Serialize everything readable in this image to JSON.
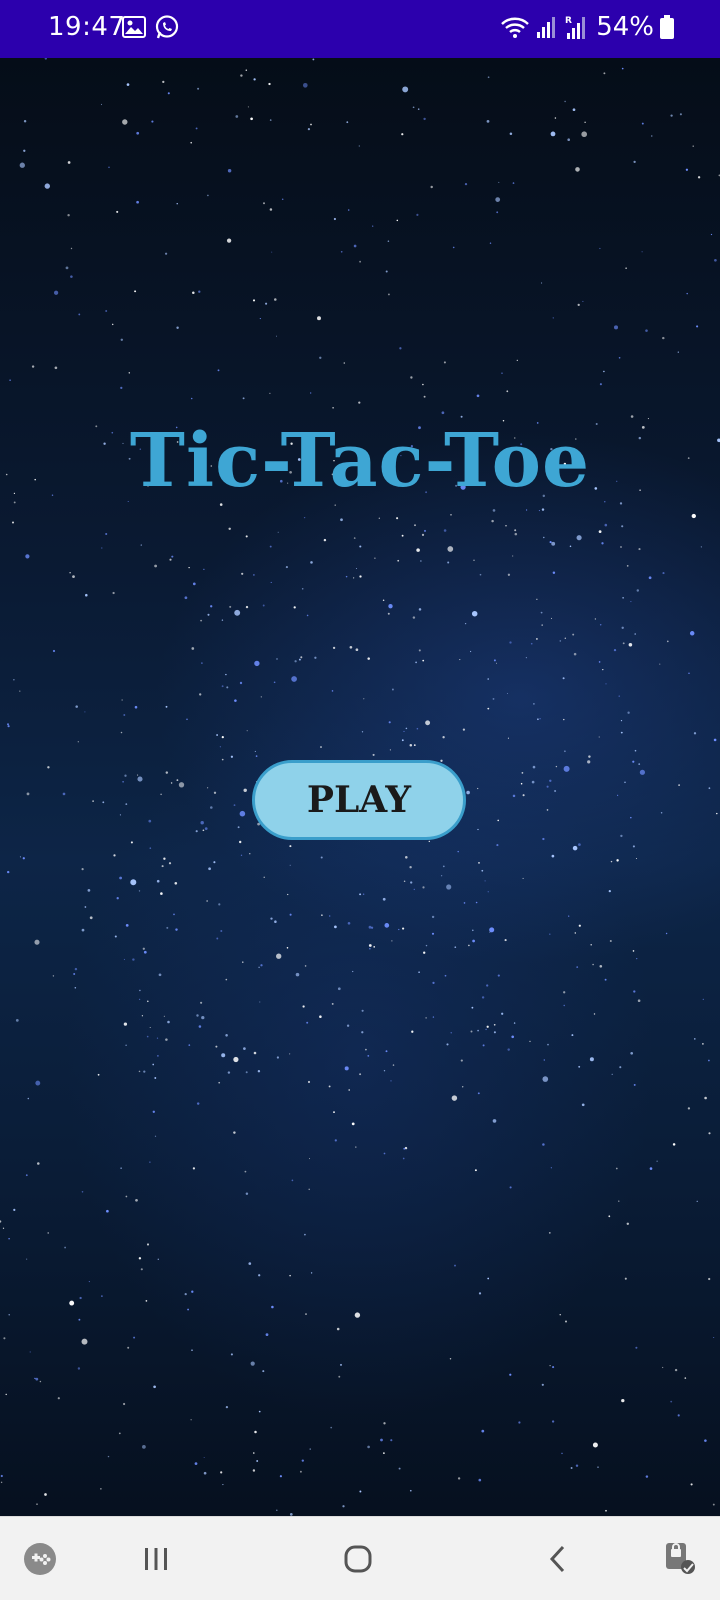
{
  "status_bar": {
    "time": "19:47",
    "battery": "54%",
    "background": "#2c00ad",
    "icons": [
      "gallery-icon",
      "whatsapp-icon",
      "wifi-icon",
      "signal-icon",
      "roaming-signal-icon",
      "battery-icon"
    ]
  },
  "app": {
    "title": "Tic-Tac-Toe",
    "play_label": "PLAY",
    "title_color": "#3ea6d4",
    "button_color": "#8fd2ea"
  },
  "nav_bar": {
    "icons": [
      "game-launcher-icon",
      "recent-apps-icon",
      "home-icon",
      "back-icon",
      "keyboard-security-icon"
    ]
  }
}
